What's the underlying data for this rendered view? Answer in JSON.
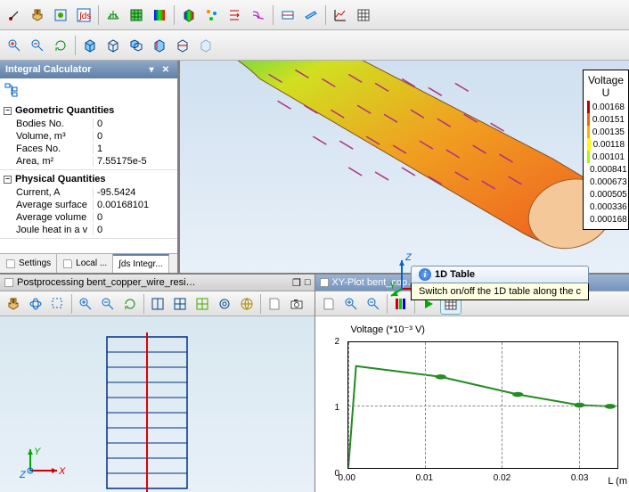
{
  "panel": {
    "title": "Integral Calculator",
    "sections": [
      {
        "name": "Geometric Quantities",
        "rows": [
          {
            "label": "Bodies No.",
            "value": "0"
          },
          {
            "label": "Volume, m³",
            "value": "0"
          },
          {
            "label": "Faces No.",
            "value": "1"
          },
          {
            "label": "Area, m²",
            "value": "7.55175e-5"
          }
        ]
      },
      {
        "name": "Physical Quantities",
        "rows": [
          {
            "label": "Current, A",
            "value": "-95.5424"
          },
          {
            "label": "Average surface",
            "value": "0.00168101"
          },
          {
            "label": "Average volume",
            "value": "0"
          },
          {
            "label": "Joule heat in a v",
            "value": "0"
          }
        ]
      }
    ],
    "tabs": [
      "Settings",
      "Local ...",
      "∫ds Integr..."
    ]
  },
  "legend3d": {
    "title": "Voltage U",
    "items": [
      {
        "color": "#c00000",
        "val": "0.00168"
      },
      {
        "color": "#ff6000",
        "val": "0.00151"
      },
      {
        "color": "#ffb000",
        "val": "0.00135"
      },
      {
        "color": "#ffff00",
        "val": "0.00118"
      },
      {
        "color": "#a0ff00",
        "val": "0.00101"
      },
      {
        "color": "#30ff80",
        "val": "0.000841"
      },
      {
        "color": "#00ffc0",
        "val": "0.000673"
      },
      {
        "color": "#00e0ff",
        "val": "0.000505"
      },
      {
        "color": "#00a0ff",
        "val": "0.000336"
      },
      {
        "color": "#0060ff",
        "val": "0.000168"
      }
    ]
  },
  "axis3d": {
    "x": "X",
    "y": "Y",
    "z": "Z"
  },
  "axis2d": {
    "x": "X",
    "y": "Y",
    "z": "Z"
  },
  "postTitle": "Postprocessing bent_copper_wire_resi…",
  "xyTitle": "XY-Plot bent_cop…",
  "tooltip": {
    "title": "1D Table",
    "body": "Switch on/off the 1D table along the c"
  },
  "chart_data": {
    "type": "line",
    "title": "Voltage (*10⁻³ V)",
    "xlabel": "L (m",
    "ylabel": "",
    "xlim": [
      0,
      0.035
    ],
    "ylim": [
      0,
      2
    ],
    "xticks": [
      0.0,
      0.01,
      0.02,
      0.03
    ],
    "yticks": [
      0,
      1,
      2
    ],
    "x": [
      0.0,
      0.001,
      0.012,
      0.022,
      0.03,
      0.034
    ],
    "y": [
      0.0,
      1.62,
      1.45,
      1.17,
      1.0,
      0.98
    ],
    "markers_x": [
      0.012,
      0.022,
      0.03,
      0.034
    ],
    "markers_y": [
      1.45,
      1.17,
      1.0,
      0.98
    ]
  }
}
